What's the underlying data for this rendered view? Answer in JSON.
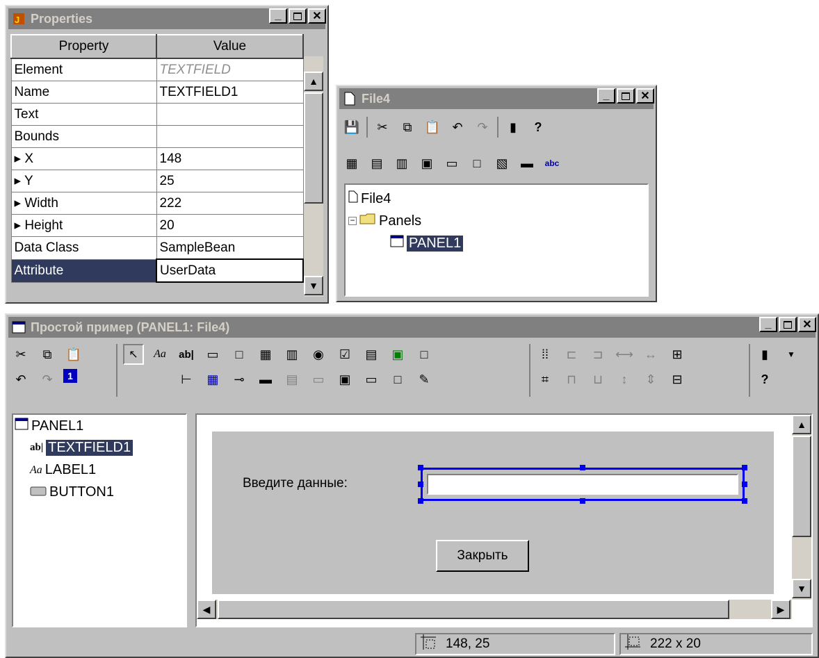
{
  "properties_window": {
    "title": "Properties",
    "headers": {
      "property": "Property",
      "value": "Value"
    },
    "rows": [
      {
        "p": "Element",
        "v": "TEXTFIELD"
      },
      {
        "p": "Name",
        "v": "TEXTFIELD1"
      },
      {
        "p": "Text",
        "v": ""
      },
      {
        "p": "Bounds",
        "v": ""
      },
      {
        "p": "X",
        "v": "148"
      },
      {
        "p": "Y",
        "v": "25"
      },
      {
        "p": "Width",
        "v": "222"
      },
      {
        "p": "Height",
        "v": "20"
      },
      {
        "p": "Data Class",
        "v": "SampleBean"
      },
      {
        "p": "Attribute",
        "v": "UserData"
      }
    ]
  },
  "file_window": {
    "title": "File4",
    "tree": {
      "root": "File4",
      "folder": "Panels",
      "panel": "PANEL1"
    }
  },
  "main_window": {
    "title": "Простой пример (PANEL1: File4)",
    "tree": {
      "root": "PANEL1",
      "items": [
        "TEXTFIELD1",
        "LABEL1",
        "BUTTON1"
      ]
    },
    "canvas": {
      "label": "Введите данные:",
      "button": "Закрыть"
    },
    "status": {
      "position": "148, 25",
      "size": "222 x 20"
    }
  },
  "colors": {
    "selection": "#303a5c",
    "handles": "#0000ee",
    "titlebar_inactive": "#808080"
  }
}
